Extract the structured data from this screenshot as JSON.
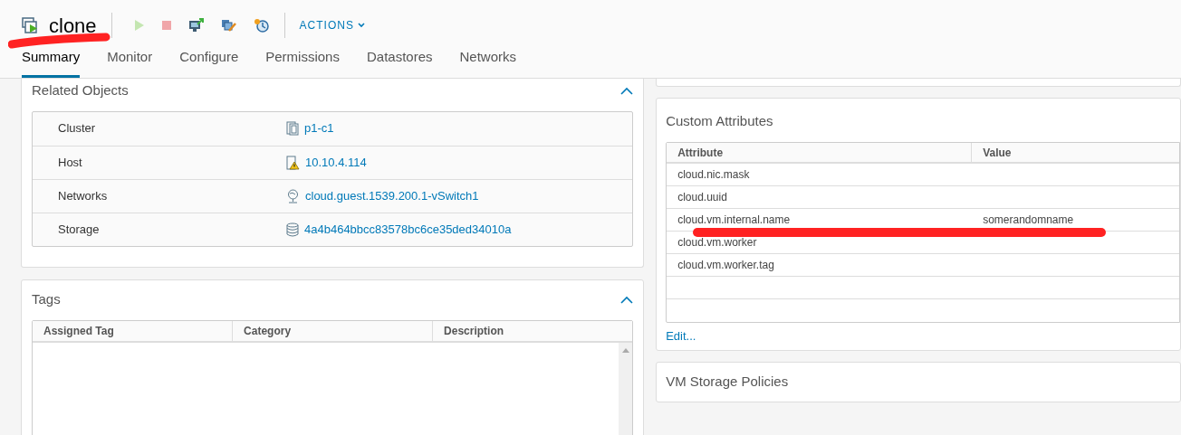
{
  "header": {
    "title": "clone",
    "actions_label": "ACTIONS"
  },
  "toolbar": [
    {
      "kind": "power-on",
      "disabled": true
    },
    {
      "kind": "power-off",
      "disabled": true
    },
    {
      "kind": "console",
      "disabled": false
    },
    {
      "kind": "edit",
      "disabled": false
    },
    {
      "kind": "snapshot",
      "disabled": false
    }
  ],
  "tabs": [
    {
      "label": "Summary",
      "selected": true
    },
    {
      "label": "Monitor",
      "selected": false
    },
    {
      "label": "Configure",
      "selected": false
    },
    {
      "label": "Permissions",
      "selected": false
    },
    {
      "label": "Datastores",
      "selected": false
    },
    {
      "label": "Networks",
      "selected": false
    }
  ],
  "related_objects": {
    "title": "Related Objects",
    "expanded": true,
    "rows": [
      {
        "label": "Cluster",
        "value": "p1-c1",
        "kind": "cluster"
      },
      {
        "label": "Host",
        "value": "10.10.4.114",
        "kind": "host-warning"
      },
      {
        "label": "Networks",
        "value": "cloud.guest.1539.200.1-vSwitch1",
        "kind": "network"
      },
      {
        "label": "Storage",
        "value": "4a4b464bbcc83578bc6ce35ded34010a",
        "kind": "datastore"
      }
    ]
  },
  "tags": {
    "title": "Tags",
    "expanded": true,
    "columns": [
      "Assigned Tag",
      "Category",
      "Description"
    ]
  },
  "custom_attributes": {
    "title": "Custom Attributes",
    "columns": [
      "Attribute",
      "Value"
    ],
    "rows": [
      {
        "attribute": "cloud.nic.mask"
      },
      {
        "attribute": "cloud.uuid"
      },
      {
        "attribute": "cloud.vm.internal.name",
        "value": "somerandomname"
      },
      {
        "attribute": "cloud.vm.worker"
      },
      {
        "attribute": "cloud.vm.worker.tag"
      }
    ],
    "edit_link": "Edit..."
  },
  "storage_policies": {
    "title": "VM Storage Policies"
  }
}
